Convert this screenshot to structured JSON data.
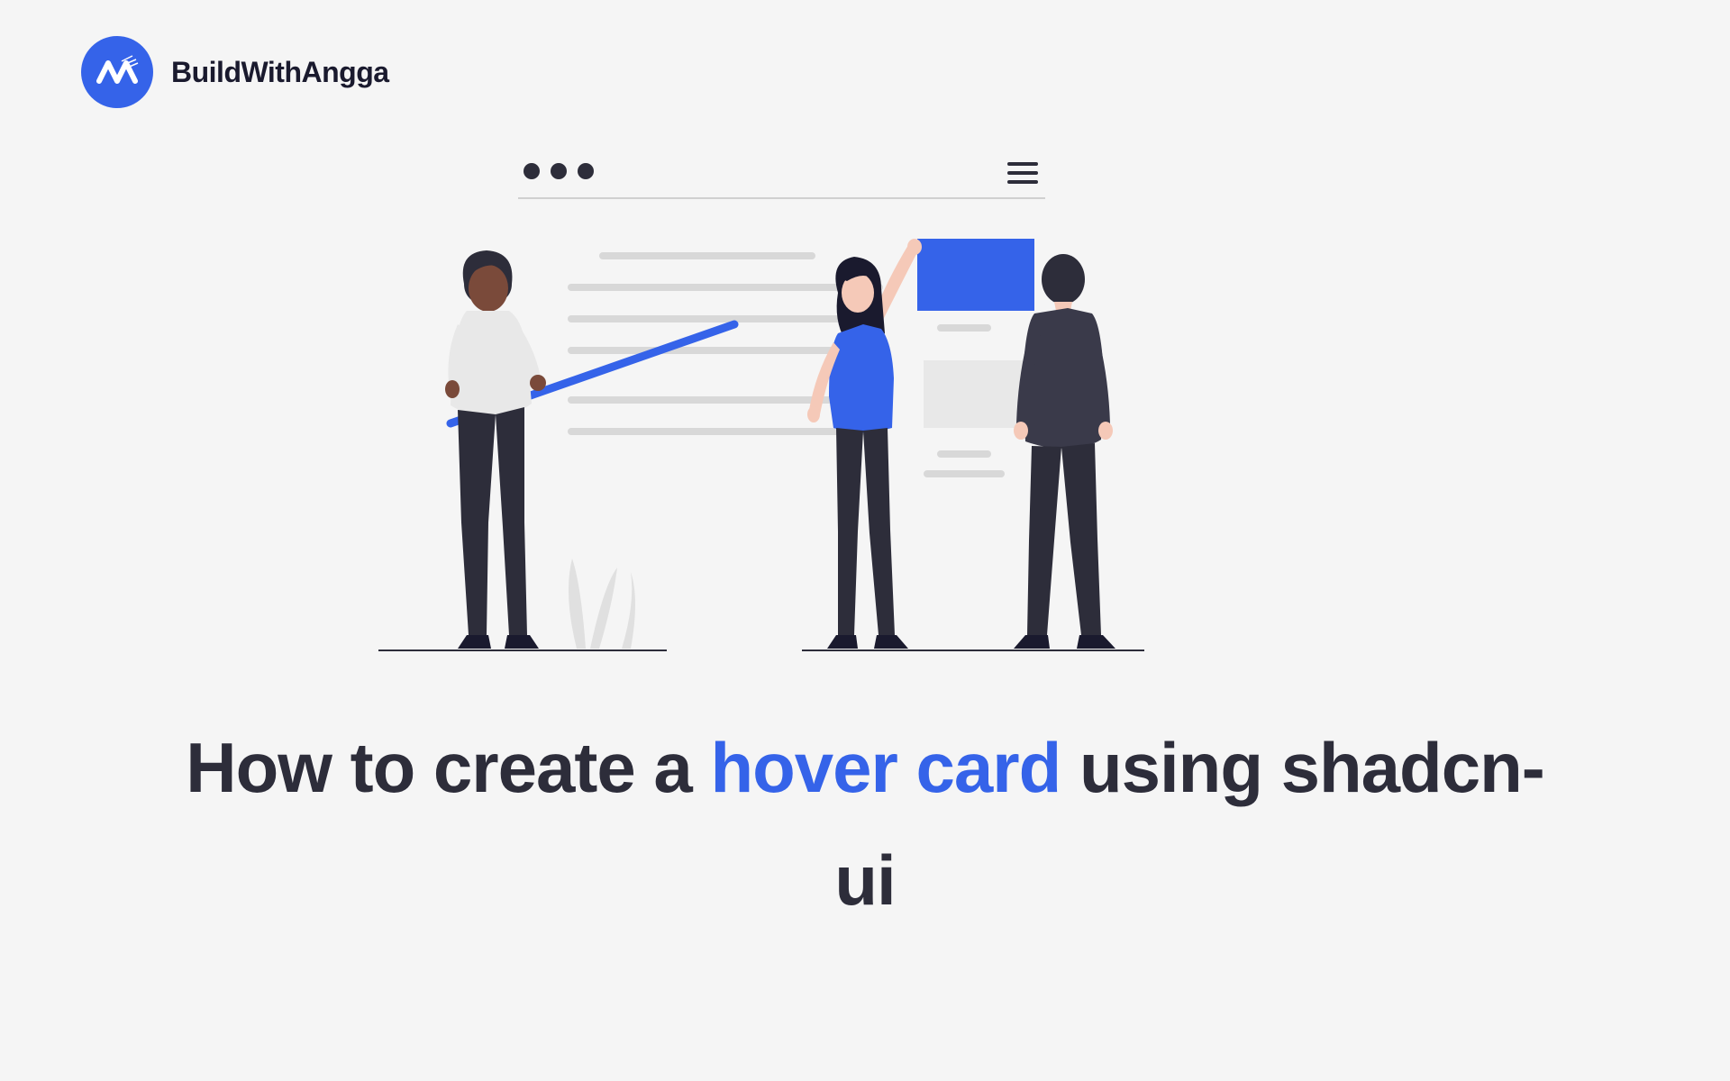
{
  "brand": {
    "name": "BuildWithAngga"
  },
  "title": {
    "part1": "How to create a ",
    "accent1": "hover card",
    "part2": " using shadcn-ui"
  },
  "colors": {
    "accent": "#3563E9",
    "text_dark": "#2d2d3a",
    "bg": "#f5f5f5"
  }
}
